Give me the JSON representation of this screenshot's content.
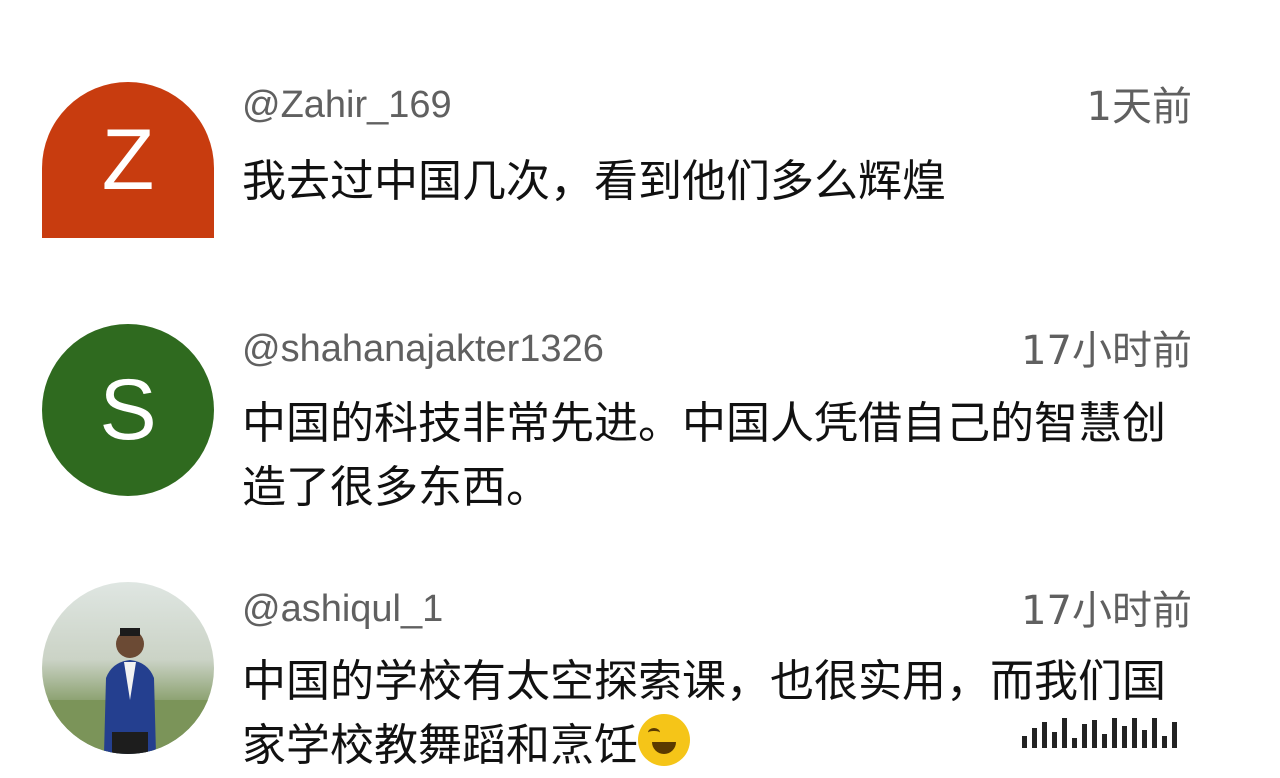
{
  "comments": [
    {
      "username": "@Zahir_169",
      "time": "1天前",
      "avatar_letter": "Z",
      "avatar_color": "#c83c0f",
      "text": "我去过中国几次，看到他们多么辉煌"
    },
    {
      "username": "@shahanajakter1326",
      "time": "17小时前",
      "avatar_letter": "S",
      "avatar_color": "#2f6a1f",
      "text": "中国的科技非常先进。中国人凭借自己的智慧创造了很多东西。"
    },
    {
      "username": "@ashiqul_1",
      "time": "17小时前",
      "avatar_letter": "",
      "avatar_color": "#b7c6b0",
      "text": "中国的学校有太空探索课，也很实用，而我们国家学校教舞蹈和烹饪",
      "emoji": "laughing-with-tears-emoji"
    }
  ]
}
